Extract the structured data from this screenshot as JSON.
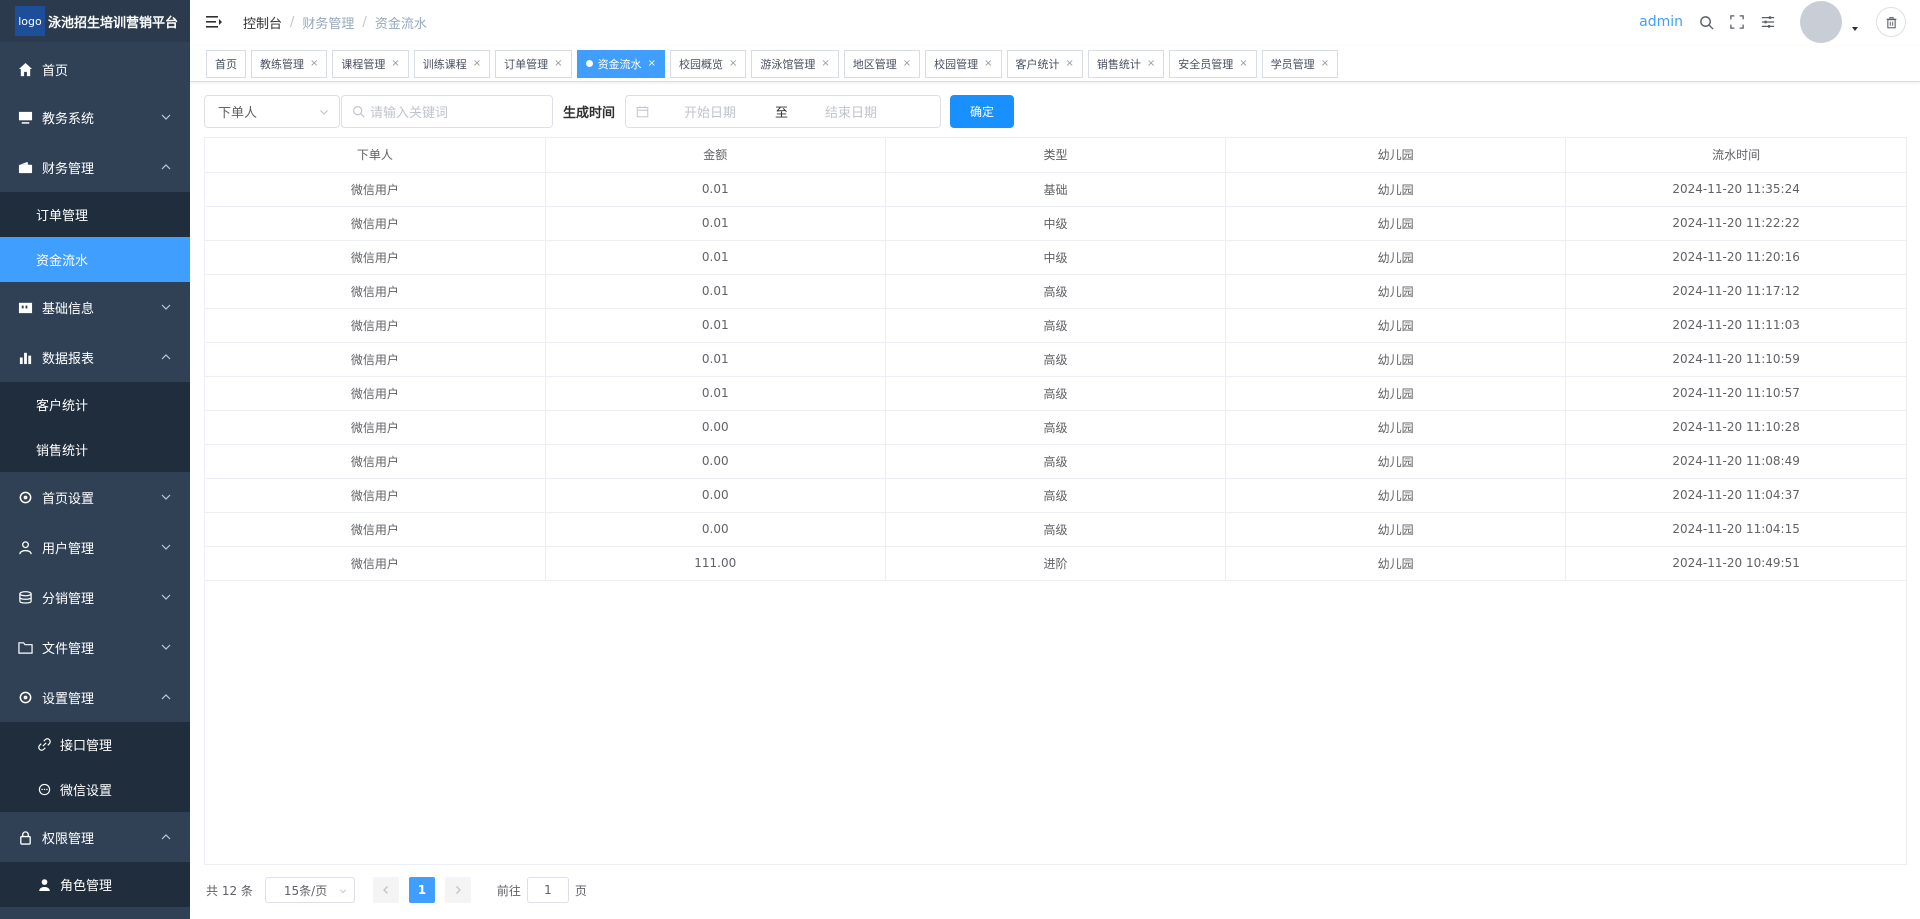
{
  "brand": {
    "logo": "logo",
    "name": "泳池招生培训营销平台"
  },
  "sidebar": {
    "items": [
      {
        "label": "首页"
      },
      {
        "label": "教务系统"
      },
      {
        "label": "财务管理",
        "children": [
          {
            "label": "订单管理"
          },
          {
            "label": "资金流水"
          }
        ]
      },
      {
        "label": "基础信息"
      },
      {
        "label": "数据报表",
        "children": [
          {
            "label": "客户统计"
          },
          {
            "label": "销售统计"
          }
        ]
      },
      {
        "label": "首页设置"
      },
      {
        "label": "用户管理"
      },
      {
        "label": "分销管理"
      },
      {
        "label": "文件管理"
      },
      {
        "label": "设置管理",
        "children": [
          {
            "label": "接口管理"
          },
          {
            "label": "微信设置"
          }
        ]
      },
      {
        "label": "权限管理",
        "children": [
          {
            "label": "角色管理"
          }
        ]
      }
    ]
  },
  "header": {
    "breadcrumb": [
      "控制台",
      "财务管理",
      "资金流水"
    ],
    "username": "admin"
  },
  "tags": [
    "首页",
    "教练管理",
    "课程管理",
    "训练课程",
    "订单管理",
    "资金流水",
    "校园概览",
    "游泳馆管理",
    "地区管理",
    "校园管理",
    "客户统计",
    "销售统计",
    "安全员管理",
    "学员管理"
  ],
  "filter": {
    "select_value": "下单人",
    "search_placeholder": "请输入关键词",
    "time_label": "生成时间",
    "start_placeholder": "开始日期",
    "range_sep": "至",
    "end_placeholder": "结束日期",
    "confirm": "确定"
  },
  "table": {
    "columns": [
      "下单人",
      "金额",
      "类型",
      "幼儿园",
      "流水时间"
    ],
    "rows": [
      [
        "微信用户",
        "0.01",
        "基础",
        "幼儿园",
        "2024-11-20 11:35:24"
      ],
      [
        "微信用户",
        "0.01",
        "中级",
        "幼儿园",
        "2024-11-20 11:22:22"
      ],
      [
        "微信用户",
        "0.01",
        "中级",
        "幼儿园",
        "2024-11-20 11:20:16"
      ],
      [
        "微信用户",
        "0.01",
        "高级",
        "幼儿园",
        "2024-11-20 11:17:12"
      ],
      [
        "微信用户",
        "0.01",
        "高级",
        "幼儿园",
        "2024-11-20 11:11:03"
      ],
      [
        "微信用户",
        "0.01",
        "高级",
        "幼儿园",
        "2024-11-20 11:10:59"
      ],
      [
        "微信用户",
        "0.01",
        "高级",
        "幼儿园",
        "2024-11-20 11:10:57"
      ],
      [
        "微信用户",
        "0.00",
        "高级",
        "幼儿园",
        "2024-11-20 11:10:28"
      ],
      [
        "微信用户",
        "0.00",
        "高级",
        "幼儿园",
        "2024-11-20 11:08:49"
      ],
      [
        "微信用户",
        "0.00",
        "高级",
        "幼儿园",
        "2024-11-20 11:04:37"
      ],
      [
        "微信用户",
        "0.00",
        "高级",
        "幼儿园",
        "2024-11-20 11:04:15"
      ],
      [
        "微信用户",
        "111.00",
        "进阶",
        "幼儿园",
        "2024-11-20 10:49:51"
      ]
    ]
  },
  "pagination": {
    "total": "共 12 条",
    "page_size": "15条/页",
    "current": "1",
    "goto_label": "前往",
    "goto_value": "1",
    "page_suffix": "页"
  },
  "colors": {
    "sidebar_bg": "#304156",
    "accent": "#409eff",
    "submenu_bg": "#1f2d3d"
  }
}
